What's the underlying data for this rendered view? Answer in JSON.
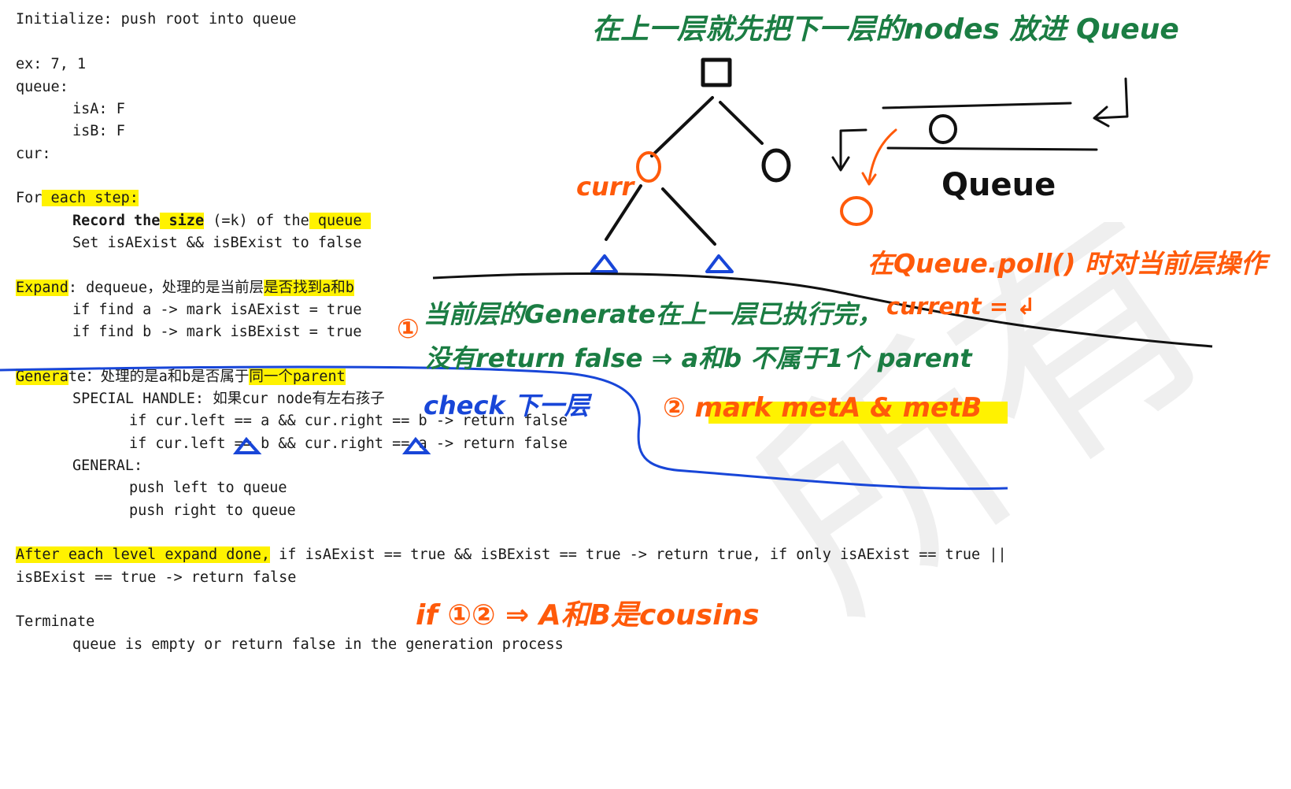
{
  "notes": {
    "l1": "Initialize: push root into queue",
    "l2": "ex: 7, 1",
    "l3": "queue:",
    "l4": "isA: F",
    "l5": "isB: F",
    "l6": "cur:",
    "l7a": "For",
    "l7b": " each step:",
    "l8a": "Record the",
    "l8b": " size",
    "l8c": " (=k) of the",
    "l8d": " queue ",
    "l9": "Set isAExist && isBExist to false",
    "l10a": "Expand",
    "l10b": ": dequeue，处理的是当前层",
    "l10c": "是否找到a和b",
    "l11": "if find a -> mark isAExist = true",
    "l12": "if find b -> mark isBExist = true",
    "l13a": "Genera",
    "l13b": "te：处理的是a和b是否属于",
    "l13c": "同一个parent",
    "l14": "SPECIAL HANDLE: 如果cur node有左右孩子",
    "l15": "if cur.left == a && cur.right == b -> return false",
    "l16": "if cur.left == b && cur.right == a -> return false",
    "l17": "GENERAL:",
    "l18": "push left to queue",
    "l19": "push right to queue",
    "l20a": "After each level expand done,",
    "l20b": " if isAExist == true && isBExist == true -> return true, if only isAExist == true ||",
    "l21": "isBExist == true -> return false",
    "l22": "Terminate",
    "l23": "queue is empty or return false in the generation process"
  },
  "handwriting": {
    "top_note": "在上一层就先把下一层的nodes 放进 Queue",
    "curr": "curr",
    "queue": "Queue",
    "poll_note": "在Queue.poll() 时对当前层操作",
    "current": "current = ↲",
    "circle1": "①",
    "gen_note1": "当前层的Generate在上一层已执行完，",
    "gen_note2": "没有return false ⇒ a和b 不属于1个 parent",
    "check": "check 下一层",
    "mark": "② mark metA & metB",
    "cousins": "if ①② ⇒ A和B是cousins"
  },
  "colors": {
    "highlight": "#fff200",
    "green": "#1b7d43",
    "orange": "#ff5a0a",
    "blue": "#1846d8"
  }
}
